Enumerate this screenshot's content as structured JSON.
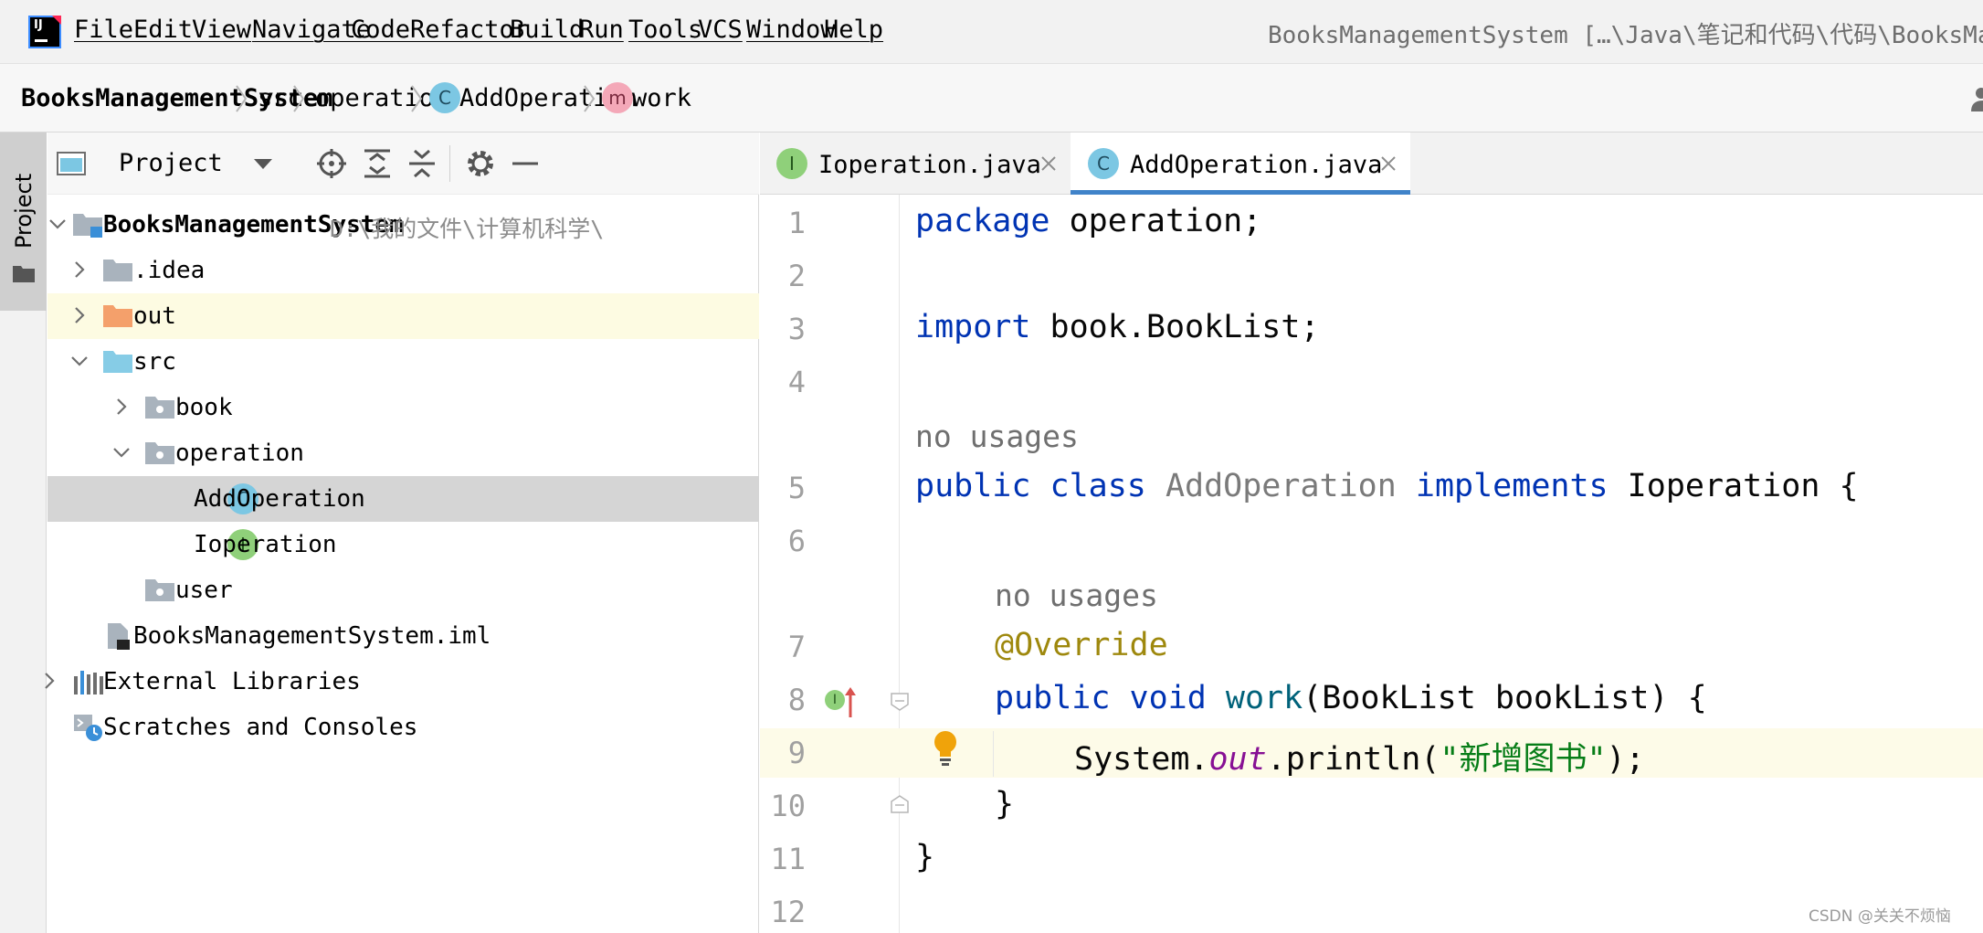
{
  "menubar": {
    "items": [
      "File",
      "Edit",
      "View",
      "Navigate",
      "Code",
      "Refactor",
      "Build",
      "Run",
      "Tools",
      "VCS",
      "Window",
      "Help"
    ],
    "window_title": "BooksManagementSystem […\\Java\\笔记和代码\\代码\\BooksMa"
  },
  "breadcrumb": {
    "project": "BooksManagementSystem",
    "src": "src",
    "package": "operation",
    "class_badge": "C",
    "class": "AddOperation",
    "method_badge": "m",
    "method": "work"
  },
  "tool_strip": {
    "project_label": "Project"
  },
  "project_panel": {
    "title": "Project",
    "tree": {
      "root": {
        "label": "BooksManagementSystem",
        "path": "D:\\我的文件\\计算机科学\\"
      },
      "idea": ".idea",
      "out": "out",
      "src": "src",
      "book": "book",
      "operation": "operation",
      "add_operation": {
        "badge": "C",
        "label": "AddOperation"
      },
      "ioperation": {
        "badge": "I",
        "label": "Ioperation"
      },
      "user": "user",
      "iml": "BooksManagementSystem.iml",
      "external_libraries": "External Libraries",
      "scratches": "Scratches and Consoles"
    }
  },
  "editor": {
    "tabs": [
      {
        "badge": "I",
        "label": "Ioperation.java",
        "active": false
      },
      {
        "badge": "C",
        "label": "AddOperation.java",
        "active": true
      }
    ],
    "line_numbers": [
      "1",
      "2",
      "3",
      "4",
      "5",
      "6",
      "7",
      "8",
      "9",
      "10",
      "11",
      "12"
    ],
    "code": {
      "l1_kw": "package",
      "l1_rest": " operation;",
      "l3_kw": "import",
      "l3_rest": " book.BookList;",
      "hint_class": "no usages",
      "l5_kw1": "public class",
      "l5_name": " AddOperation",
      "l5_kw2": " implements",
      "l5_rest": " Ioperation {",
      "hint_method": "no usages",
      "l7_anno": "@Override",
      "l8_kw": "public void",
      "l8_fn": " work",
      "l8_rest": "(BookList bookList) {",
      "l9_sys": "System.",
      "l9_out": "out",
      "l9_call": ".println(",
      "l9_str": "\"新增图书\"",
      "l9_end": ");",
      "l10": "}",
      "l11": "}"
    },
    "gutter_impl_badge": "I"
  },
  "watermark": "CSDN @关关不烦恼",
  "colors": {
    "keyword": "#0033b3",
    "annotation": "#9e880d",
    "string": "#067d17",
    "static_field": "#871094",
    "method_decl": "#00627a",
    "tab_active_underline": "#4083c9"
  }
}
